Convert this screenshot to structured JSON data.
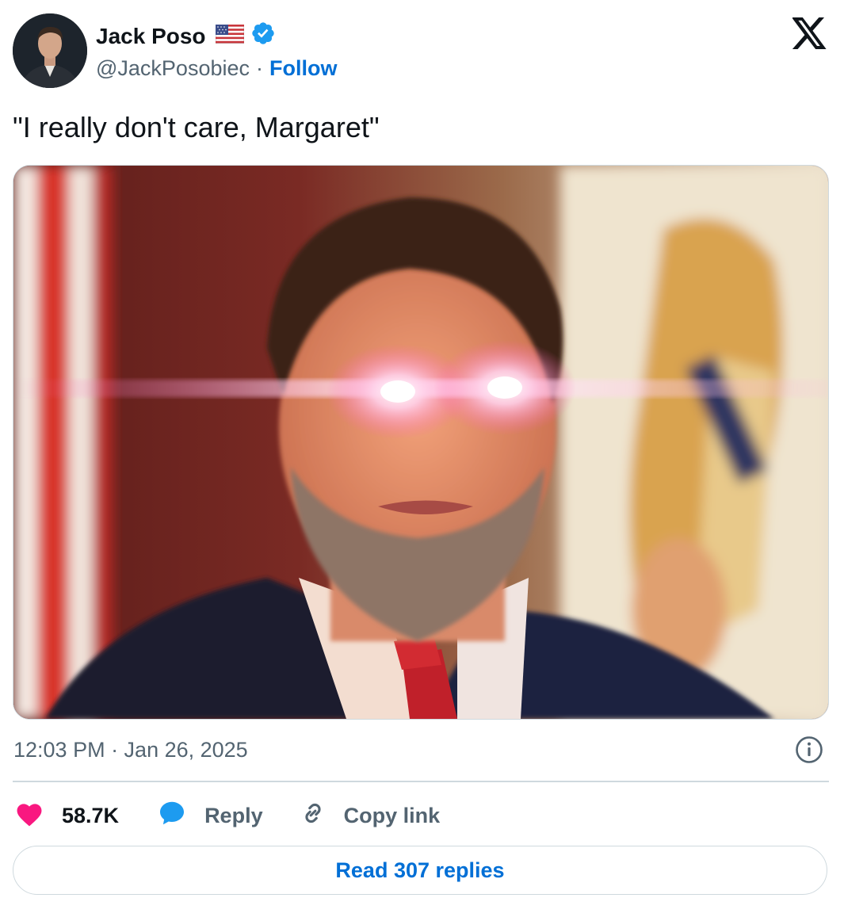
{
  "author": {
    "name": "Jack Poso",
    "handle": "@JackPosobiec",
    "separator": "·",
    "follow_label": "Follow",
    "flag_icon": "us-flag-icon",
    "verified_icon": "verified-badge-icon"
  },
  "tweet": {
    "text": "\"I really don't care, Margaret\"",
    "timestamp": "12:03 PM · Jan 26, 2025"
  },
  "actions": {
    "likes": "58.7K",
    "reply_label": "Reply",
    "copy_link_label": "Copy link"
  },
  "read_replies_label": "Read 307 replies",
  "icons": {
    "platform": "x-logo-icon",
    "info": "info-icon",
    "like": "heart-icon",
    "reply": "speech-bubble-icon",
    "copy_link": "link-icon"
  },
  "colors": {
    "link_blue": "#006fd6",
    "heart_pink": "#f91880",
    "reply_blue": "#1d9bf0",
    "text_secondary": "#536471",
    "border": "#cfd9de"
  }
}
